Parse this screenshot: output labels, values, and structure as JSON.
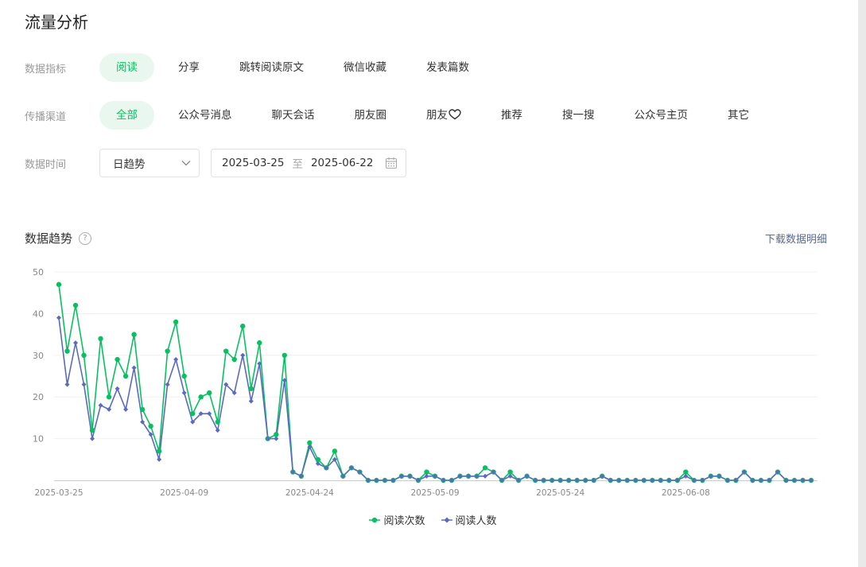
{
  "page": {
    "title": "流量分析"
  },
  "filters": {
    "metric": {
      "label": "数据指标",
      "options": [
        "阅读",
        "分享",
        "跳转阅读原文",
        "微信收藏",
        "发表篇数"
      ],
      "active": 0
    },
    "channel": {
      "label": "传播渠道",
      "options": [
        "全部",
        "公众号消息",
        "聊天会话",
        "朋友圈",
        "朋友",
        "推荐",
        "搜一搜",
        "公众号主页",
        "其它"
      ],
      "active": 0
    },
    "time": {
      "label": "数据时间",
      "mode": "日趋势",
      "start": "2025-03-25",
      "sep": "至",
      "end": "2025-06-22"
    }
  },
  "section": {
    "title": "数据趋势",
    "help": "?",
    "download": "下载数据明细"
  },
  "colors": {
    "accent": "#07c160",
    "series_reads": "#07c160",
    "series_users": "#5b6abf",
    "link": "#576b95"
  },
  "chart_data": {
    "type": "line",
    "ylim": [
      0,
      50
    ],
    "yticks": [
      10,
      20,
      30,
      40,
      50
    ],
    "x_start": "2025-03-25",
    "x_tick_labels": [
      "2025-03-25",
      "2025-04-09",
      "2025-04-24",
      "2025-05-09",
      "2025-05-24",
      "2025-06-08"
    ],
    "grid": true,
    "legend_position": "bottom",
    "series": [
      {
        "name": "阅读次数",
        "marker": "circle",
        "values": [
          47,
          31,
          42,
          30,
          12,
          34,
          20,
          29,
          25,
          35,
          17,
          13,
          7,
          31,
          38,
          25,
          16,
          20,
          21,
          14,
          31,
          29,
          37,
          22,
          33,
          10,
          11,
          30,
          2,
          1,
          9,
          5,
          3,
          7,
          1,
          3,
          2,
          0,
          0,
          0,
          0,
          1,
          1,
          0,
          2,
          1,
          0,
          0,
          1,
          1,
          1,
          3,
          2,
          0,
          2,
          0,
          1,
          0,
          0,
          0,
          0,
          0,
          0,
          0,
          0,
          1,
          0,
          0,
          0,
          0,
          0,
          0,
          0,
          0,
          0,
          2,
          0,
          0,
          1,
          1,
          0,
          0,
          2,
          0,
          0,
          0,
          2,
          0,
          0,
          0,
          0
        ]
      },
      {
        "name": "阅读人数",
        "marker": "diamond",
        "values": [
          39,
          23,
          33,
          23,
          10,
          18,
          17,
          22,
          17,
          27,
          14,
          11,
          5,
          23,
          29,
          21,
          14,
          16,
          16,
          12,
          23,
          21,
          30,
          19,
          28,
          10,
          10,
          24,
          2,
          1,
          8,
          4,
          3,
          5,
          1,
          3,
          2,
          0,
          0,
          0,
          0,
          1,
          1,
          0,
          1,
          1,
          0,
          0,
          1,
          1,
          1,
          1,
          2,
          0,
          1,
          0,
          1,
          0,
          0,
          0,
          0,
          0,
          0,
          0,
          0,
          1,
          0,
          0,
          0,
          0,
          0,
          0,
          0,
          0,
          0,
          1,
          0,
          0,
          1,
          1,
          0,
          0,
          2,
          0,
          0,
          0,
          2,
          0,
          0,
          0,
          0
        ]
      }
    ]
  }
}
